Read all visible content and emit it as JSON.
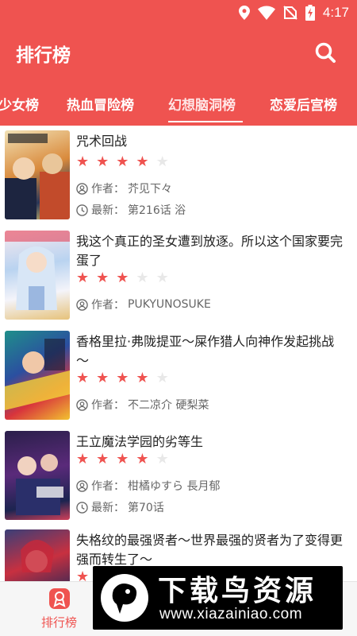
{
  "status_bar": {
    "time": "4:17",
    "icons": [
      "location-icon",
      "wifi-icon",
      "no-sim-icon",
      "battery-charging-icon"
    ]
  },
  "header": {
    "title": "排行榜",
    "search_icon": "search-icon"
  },
  "tabs": [
    {
      "label": "少女榜",
      "active": false
    },
    {
      "label": "热血冒险榜",
      "active": false
    },
    {
      "label": "幻想脑洞榜",
      "active": true
    },
    {
      "label": "恋爱后宫榜",
      "active": false
    }
  ],
  "labels": {
    "author_prefix": "作者：",
    "latest_prefix": "最新："
  },
  "items": [
    {
      "title": "咒术回战",
      "rating": 4,
      "author": "芥见下々",
      "latest": "第216话 浴"
    },
    {
      "title": "我这个真正的圣女遭到放逐。所以这个国家要完蛋了",
      "rating": 3,
      "author": "PUKYUNOSUKE",
      "latest": ""
    },
    {
      "title": "香格里拉·弗陇提亚～屎作猎人向神作发起挑战～",
      "rating": 4,
      "author": "不二凉介 硬梨菜",
      "latest": ""
    },
    {
      "title": "王立魔法学园的劣等生",
      "rating": 4,
      "author": "柑橘ゆすら 長月郁",
      "latest": "第70话"
    },
    {
      "title": "失格纹的最强贤者～世界最强的贤者为了变得更强而转生了～",
      "rating": 1,
      "author": "",
      "latest": ""
    }
  ],
  "bottom_nav": {
    "rank_label": "排行榜"
  },
  "watermark": {
    "text": "下载鸟资源",
    "url": "www.xiazainiao.com"
  },
  "colors": {
    "primary": "#ef5350",
    "star_off": "#e8e8e8"
  }
}
